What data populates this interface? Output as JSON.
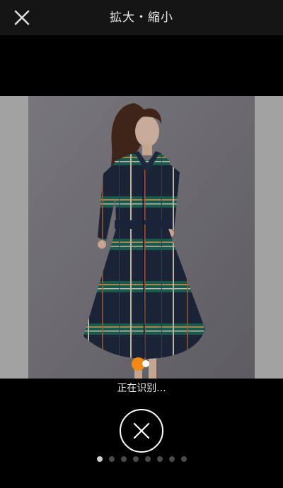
{
  "header": {
    "title": "拡大・縮小",
    "close_icon": "close-icon"
  },
  "scan": {
    "status_text": "正在识别...",
    "indicator_colors": [
      "#f08a16",
      "#ffffff"
    ]
  },
  "actions": {
    "cancel_icon": "close-circle-icon"
  },
  "pagination": {
    "count": 8,
    "active_index": 0
  },
  "colors": {
    "accent": "#f08a16",
    "background": "#000000",
    "header_bg": "#151515"
  }
}
